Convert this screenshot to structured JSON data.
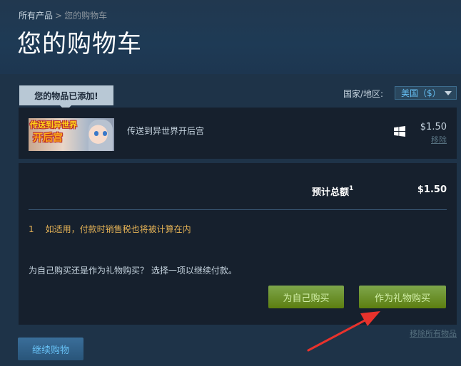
{
  "breadcrumb": {
    "root": "所有产品",
    "separator": ">",
    "current": "您的购物车"
  },
  "page_title": "您的购物车",
  "notice": {
    "added": "您的物品已添加!"
  },
  "region": {
    "label": "国家/地区:",
    "selected": "美国（$）"
  },
  "cart_item": {
    "thumb_line1": "传送到异世界",
    "thumb_line2": "开后宫",
    "name": "传送到异世界开后宫",
    "platform_icon": "windows-icon",
    "price": "$1.50",
    "remove_label": "移除"
  },
  "summary": {
    "total_label": "预计总额",
    "total_footnote": "1",
    "total_value": "$1.50",
    "tax_note_number": "1",
    "tax_note_text": "如适用，付款时销售税也将被计算在内",
    "purchase_prompt": "为自己购买还是作为礼物购买？ 选择一项以继续付款。"
  },
  "buttons": {
    "buy_for_self": "为自己购买",
    "buy_as_gift": "作为礼物购买",
    "remove_all": "移除所有物品",
    "continue_shopping": "继续购物"
  },
  "colors": {
    "background": "#1b2838",
    "accent_green": "#5c7e10",
    "accent_blue": "#67c1f5",
    "tax_note": "#e4b256",
    "annotation_arrow": "#e8322c"
  }
}
